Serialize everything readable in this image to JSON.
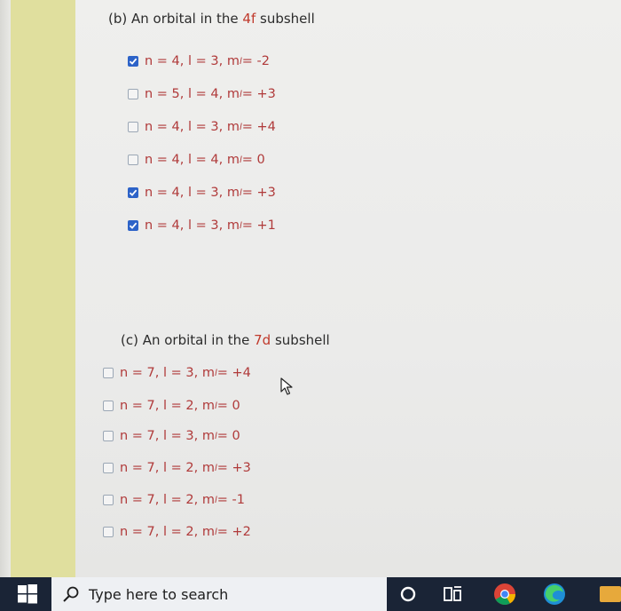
{
  "section_b": {
    "heading_prefix": "(b) An orbital in the ",
    "heading_highlight": "4f",
    "heading_suffix": " subshell",
    "options": [
      {
        "label": "n = 4, l = 3, m",
        "sub": "l",
        "value": " = -2",
        "checked": true
      },
      {
        "label": "n = 5, l = 4, m",
        "sub": "l",
        "value": " = +3",
        "checked": false
      },
      {
        "label": "n = 4, l = 3, m",
        "sub": "l",
        "value": " = +4",
        "checked": false
      },
      {
        "label": "n = 4, l = 4, m",
        "sub": "l",
        "value": " = 0",
        "checked": false
      },
      {
        "label": "n = 4, l = 3, m",
        "sub": "l",
        "value": " = +3",
        "checked": true
      },
      {
        "label": "n = 4, l = 3, m",
        "sub": "l",
        "value": " = +1",
        "checked": true
      }
    ]
  },
  "section_c": {
    "heading_prefix": "(c) An orbital in the ",
    "heading_highlight": "7d",
    "heading_suffix": " subshell",
    "options": [
      {
        "label": "n = 7, l = 3, m",
        "sub": "l",
        "value": " = +4",
        "checked": false
      },
      {
        "label": "n = 7, l = 2, m",
        "sub": "l",
        "value": " = 0",
        "checked": false
      },
      {
        "label": "n = 7, l = 3, m",
        "sub": "l",
        "value": " = 0",
        "checked": false
      },
      {
        "label": "n = 7, l = 2, m",
        "sub": "l",
        "value": " = +3",
        "checked": false
      },
      {
        "label": "n = 7, l = 2, m",
        "sub": "l",
        "value": " = -1",
        "checked": false
      },
      {
        "label": "n = 7, l = 2, m",
        "sub": "l",
        "value": " = +2",
        "checked": false
      }
    ]
  },
  "taskbar": {
    "search_placeholder": "Type here to search",
    "icons": [
      "windows-start-icon",
      "search-icon",
      "cortana-icon",
      "task-view-icon",
      "chrome-icon",
      "edge-icon"
    ]
  },
  "colors": {
    "accent_check": "#2d63c8",
    "option_text": "#b03a3a",
    "taskbar": "#1a2436"
  }
}
